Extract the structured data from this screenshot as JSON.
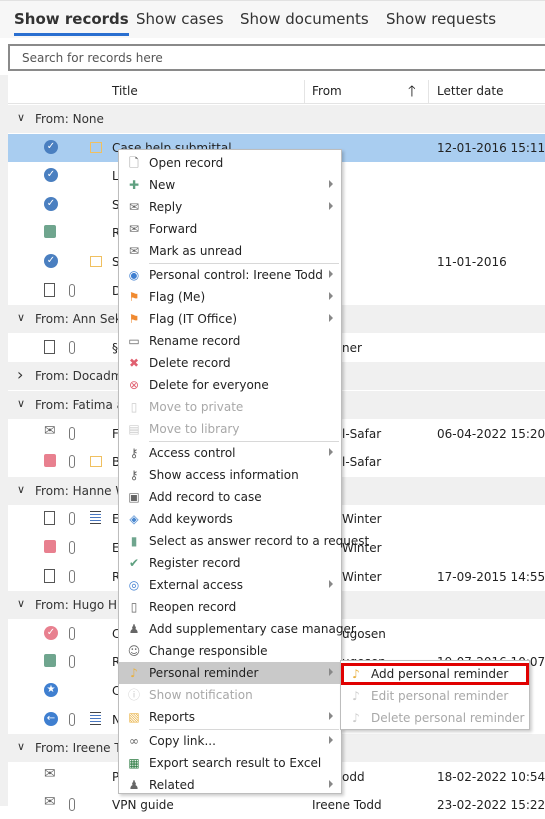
{
  "tabs": [
    {
      "label": "Show records",
      "active": true
    },
    {
      "label": "Show cases"
    },
    {
      "label": "Show documents"
    },
    {
      "label": "Show requests"
    }
  ],
  "search": {
    "placeholder": "Search for records here"
  },
  "columns": {
    "title": "Title",
    "from": "From",
    "letter_date": "Letter date",
    "sort_icon": "arrow-up-icon"
  },
  "list": [
    {
      "type": "group",
      "label": "From:  None",
      "expanded": true
    },
    {
      "type": "row",
      "icon": "check",
      "note": true,
      "title": "Case help submittal",
      "from": "",
      "date": "12-01-2016 15:11",
      "selected": true
    },
    {
      "type": "row",
      "icon": "check",
      "title": "Le",
      "from": "",
      "date": ""
    },
    {
      "type": "row",
      "icon": "check",
      "title": "Su",
      "from": "",
      "date": ""
    },
    {
      "type": "row",
      "icon": "book-green",
      "title": "Re",
      "from": "",
      "date": ""
    },
    {
      "type": "row",
      "icon": "check",
      "note": true,
      "title": "Su",
      "from": "",
      "date": "11-01-2016"
    },
    {
      "type": "row",
      "icon": "doc",
      "clip": true,
      "title": "Do",
      "from": "",
      "date": ""
    },
    {
      "type": "group",
      "label": "From:  Ann Sekn",
      "expanded": true
    },
    {
      "type": "row",
      "icon": "doc",
      "clip": true,
      "title": "§2",
      "from": "ner",
      "date": ""
    },
    {
      "type": "group",
      "label": "From:  Docadmin",
      "expanded": false
    },
    {
      "type": "group",
      "label": "From:  Fatima al-",
      "expanded": true
    },
    {
      "type": "row",
      "icon": "mail-in",
      "clip": true,
      "title": "Fv",
      "from": "l-Safar",
      "date": "06-04-2022 15:20"
    },
    {
      "type": "row",
      "icon": "book-red",
      "clip": true,
      "note": true,
      "title": "Bu",
      "from": "l-Safar",
      "date": ""
    },
    {
      "type": "group",
      "label": "From:  Hanne W",
      "expanded": true
    },
    {
      "type": "row",
      "icon": "doc",
      "clip": true,
      "list": true,
      "title": "Er",
      "from": "Winter",
      "date": ""
    },
    {
      "type": "row",
      "icon": "book-red",
      "clip": true,
      "title": "Er",
      "from": "Winter",
      "date": ""
    },
    {
      "type": "row",
      "icon": "doc",
      "clip": true,
      "title": "Re",
      "from": "Winter",
      "date": "17-09-2015 14:55"
    },
    {
      "type": "group",
      "label": "From:  Hugo Hug",
      "expanded": true
    },
    {
      "type": "row",
      "icon": "check-red",
      "clip": true,
      "title": "Cl",
      "from": "ugosen",
      "date": ""
    },
    {
      "type": "row",
      "icon": "book-info",
      "clip": true,
      "title": "Re",
      "from": "ugosen",
      "date": "19-07-2016 10:07"
    },
    {
      "type": "row",
      "icon": "badge-blue",
      "title": "Cl",
      "from": "",
      "date": ""
    },
    {
      "type": "row",
      "icon": "back-blue",
      "clip": true,
      "list": true,
      "title": "N",
      "from": "",
      "date": ""
    },
    {
      "type": "group",
      "label": "From:  Ireene To",
      "expanded": true
    },
    {
      "type": "row",
      "icon": "mail-in",
      "title": "Pl",
      "from": "odd",
      "date": "18-02-2022 10:54"
    },
    {
      "type": "row",
      "icon": "mail",
      "clip": true,
      "title": "VPN guide",
      "from": "Ireene Todd",
      "date": "23-02-2022 15:22"
    }
  ],
  "context_menu": [
    {
      "label": "Open record",
      "icon": "document-icon"
    },
    {
      "label": "New",
      "icon": "plus-icon",
      "submenu": true
    },
    {
      "label": "Reply",
      "icon": "reply-mail-icon",
      "submenu": true
    },
    {
      "label": "Forward",
      "icon": "forward-mail-icon"
    },
    {
      "label": "Mark as unread",
      "icon": "mail-icon",
      "sep_after": true
    },
    {
      "label": "Personal control: Ireene Todd",
      "icon": "eye-icon",
      "submenu": true
    },
    {
      "label": "Flag (Me)",
      "icon": "flag-icon",
      "submenu": true
    },
    {
      "label": "Flag (IT Office)",
      "icon": "flag-icon",
      "submenu": true
    },
    {
      "label": "Rename record",
      "icon": "rename-icon"
    },
    {
      "label": "Delete record",
      "icon": "x-icon"
    },
    {
      "label": "Delete for everyone",
      "icon": "x-circle-icon"
    },
    {
      "label": "Move to private",
      "icon": "lock-doc-icon",
      "disabled": true
    },
    {
      "label": "Move to library",
      "icon": "library-icon",
      "disabled": true,
      "sep_after": true
    },
    {
      "label": "Access control",
      "icon": "key-icon",
      "submenu": true
    },
    {
      "label": "Show access information",
      "icon": "key-icon"
    },
    {
      "label": "Add record to case",
      "icon": "briefcase-icon"
    },
    {
      "label": "Add keywords",
      "icon": "tag-icon"
    },
    {
      "label": "Select as answer record to a request",
      "icon": "book-icon"
    },
    {
      "label": "Register record",
      "icon": "checkmark-icon"
    },
    {
      "label": "External access",
      "icon": "globe-icon",
      "submenu": true
    },
    {
      "label": "Reopen record",
      "icon": "reopen-icon"
    },
    {
      "label": "Add supplementary case manager",
      "icon": "users-add-icon"
    },
    {
      "label": "Change responsible",
      "icon": "user-icon"
    },
    {
      "label": "Personal reminder",
      "icon": "bell-icon",
      "submenu": true,
      "highlighted": true
    },
    {
      "label": "Show notification",
      "icon": "info-icon",
      "disabled": true
    },
    {
      "label": "Reports",
      "icon": "report-icon",
      "submenu": true,
      "sep_after": true
    },
    {
      "label": "Copy link...",
      "icon": "link-icon",
      "submenu": true
    },
    {
      "label": "Export search result to Excel",
      "icon": "excel-icon"
    },
    {
      "label": "Related",
      "icon": "related-icon",
      "submenu": true
    }
  ],
  "submenu": [
    {
      "label": "Add personal reminder",
      "icon": "bell-add-icon",
      "focused": true
    },
    {
      "label": "Edit personal reminder",
      "icon": "bell-edit-icon",
      "disabled": true
    },
    {
      "label": "Delete personal reminder",
      "icon": "bell-delete-icon",
      "disabled": true
    }
  ],
  "colors": {
    "accent": "#2a6fd0",
    "selection": "#a9cdf0",
    "focus_outline": "#e00000",
    "menu_highlight": "#c9c9c9"
  }
}
